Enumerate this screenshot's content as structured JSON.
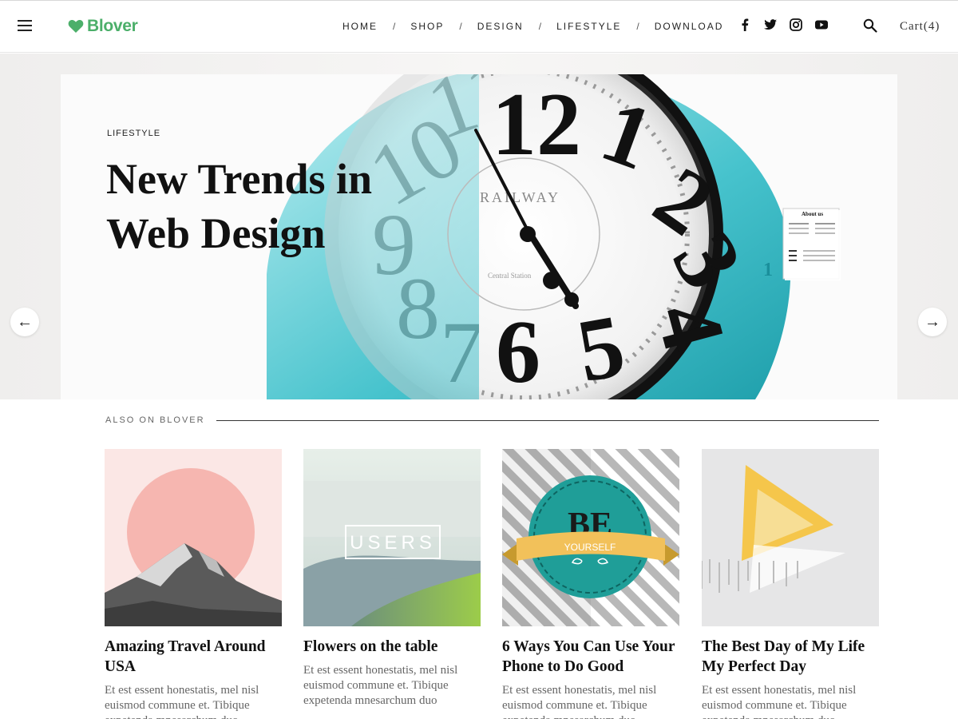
{
  "brand": {
    "name": "Blover",
    "accent": "#4caf6a"
  },
  "nav": {
    "items": [
      "HOME",
      "SHOP",
      "DESIGN",
      "LIFESTYLE",
      "DOWNLOAD"
    ],
    "separator": "/"
  },
  "social": [
    "facebook-icon",
    "twitter-icon",
    "instagram-icon",
    "youtube-icon"
  ],
  "cart": {
    "label": "Cart(4)"
  },
  "hero": {
    "category": "LIFESTYLE",
    "title": "New Trends in Web Design",
    "prev_arrow": "←",
    "next_arrow": "→",
    "clock_brand": "RAILWAY",
    "clock_text": "Central Station",
    "card_title": "About us",
    "card_number": "1"
  },
  "related": {
    "label": "ALSO ON BLOVER",
    "posts": [
      {
        "title": "Amazing Travel Around USA",
        "excerpt": "Et est essent honestatis, mel nisl euismod commune et. Tibique expetenda mnesarchum duo"
      },
      {
        "title": "Flowers on the table",
        "excerpt": "Et est essent honestatis, mel nisl euismod commune et. Tibique expetenda mnesarchum duo",
        "image_text": "USERS"
      },
      {
        "title": "6 Ways You Can Use Your Phone to Do Good",
        "excerpt": "Et est essent honestatis, mel nisl euismod commune et. Tibique expetenda mnesarchum duo",
        "image_text": "BE",
        "image_subtext": "YOURSELF"
      },
      {
        "title": "The Best Day of My Life My Perfect Day",
        "excerpt": "Et est essent honestatis, mel nisl euismod commune et. Tibique expetenda mnesarchum duo"
      }
    ]
  }
}
